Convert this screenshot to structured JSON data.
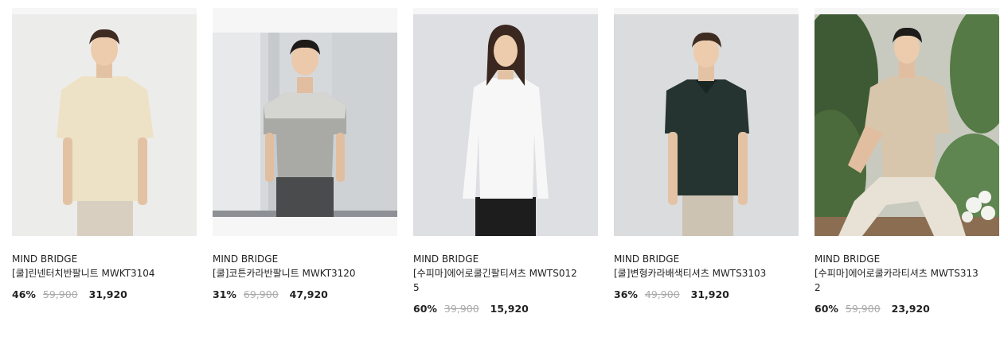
{
  "products": [
    {
      "brand": "MIND BRIDGE",
      "name": "[쿨]린넨터치반팔니트 MWKT3104",
      "discount": "46%",
      "original_price": "59,900",
      "sale_price": "31,920"
    },
    {
      "brand": "MIND BRIDGE",
      "name": "[쿨]코튼카라반팔니트 MWKT3120",
      "discount": "31%",
      "original_price": "69,900",
      "sale_price": "47,920"
    },
    {
      "brand": "MIND BRIDGE",
      "name": "[수피마]에어로쿨긴팔티셔츠 MWTS0125",
      "discount": "60%",
      "original_price": "39,900",
      "sale_price": "15,920"
    },
    {
      "brand": "MIND BRIDGE",
      "name": "[쿨]변형카라배색티셔츠 MWTS3103",
      "discount": "36%",
      "original_price": "49,900",
      "sale_price": "31,920"
    },
    {
      "brand": "MIND BRIDGE",
      "name": "[수피마]에어로쿨카라티셔츠 MWTS3132",
      "discount": "60%",
      "original_price": "59,900",
      "sale_price": "23,920"
    }
  ]
}
